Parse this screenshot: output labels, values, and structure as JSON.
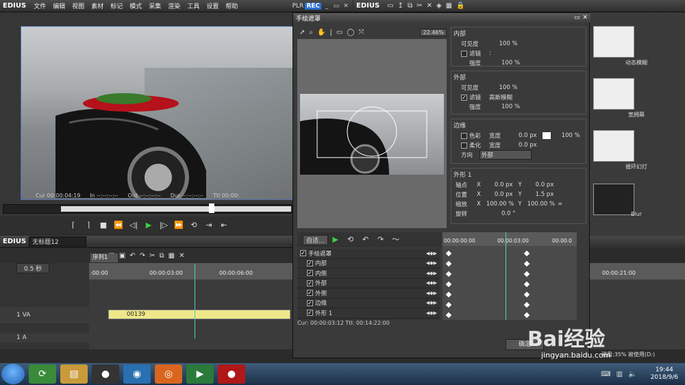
{
  "app": {
    "name": "EDIUS",
    "plr": "PLR",
    "rec": "REC"
  },
  "menu": [
    "文件",
    "编辑",
    "视图",
    "素材",
    "标记",
    "模式",
    "采集",
    "渲染",
    "工具",
    "设置",
    "帮助"
  ],
  "bin": {
    "name": "EDIUS"
  },
  "player": {
    "cur": "Cur 00:00:04:19",
    "in": "In --:--:--:--",
    "out": "Out --:--:--:--",
    "dur": "Dur --:--:--:--",
    "ttl": "Ttl 00:00:"
  },
  "fx_tiles": [
    "动态模糊",
    "宽拥幕",
    "循环幻灯",
    "Blur"
  ],
  "dialog": {
    "title": "手绘遮罩",
    "zoom": "22.46%",
    "inner": {
      "title": "内部",
      "opacity_label": "可见度",
      "opacity": "100 %",
      "filter_label": "滤镜",
      "filter_value": ":",
      "strength_label": "强度",
      "strength": "100 %"
    },
    "outer": {
      "title": "外部",
      "opacity_label": "可见度",
      "opacity": "100 %",
      "filter_label": "滤镜",
      "filter_value": "高斯模糊",
      "strength_label": "强度",
      "strength": "100 %"
    },
    "edge": {
      "title": "边缘",
      "color_label": "色彩",
      "width_label": "宽度",
      "color_width": "0.0 px",
      "color_pct": "100 %",
      "soft_label": "柔化",
      "soft_width": "0.0 px",
      "dir_label": "方向",
      "dir_value": "外部"
    },
    "shape": {
      "title": "外形 1",
      "pivot_label": "轴点",
      "pivot_x": "0.0 px",
      "pivot_y": "0.0 px",
      "pos_label": "位置",
      "pos_x": "0.0 px",
      "pos_y": "1.5 px",
      "scale_label": "缩放",
      "scale_x": "100.00 %",
      "scale_y": "100.00 %",
      "rot_label": "旋转",
      "rot": "0.0 °"
    },
    "kf_mode": "自适...",
    "tracks": [
      "手绘遮罩",
      "内部",
      "内侧",
      "外部",
      "外侧",
      "边缘",
      "外形 1"
    ],
    "ruler": [
      "00:00:00:00",
      "00:00:03:00",
      "00:00:0"
    ],
    "status": "Cur: 00:00:03:12  Ttl: 00:14:22:00",
    "ok": "确定"
  },
  "timeline": {
    "title": "无标题12",
    "tab": "序列1",
    "scale": "0.5 秒",
    "ruler": [
      ":00:00",
      "00:00:03:00",
      "00:00:06:00"
    ],
    "ruler2": "00:00:21:00",
    "track_va": "1 VA",
    "track_a": "1 A",
    "clip": "00139",
    "status": "磁盘:35% 被使用(D:)"
  },
  "taskbar": {
    "time": "19:44",
    "date": "2018/9/6"
  },
  "watermark": {
    "text": "Bai经验",
    "url": "jingyan.baidu.com"
  }
}
